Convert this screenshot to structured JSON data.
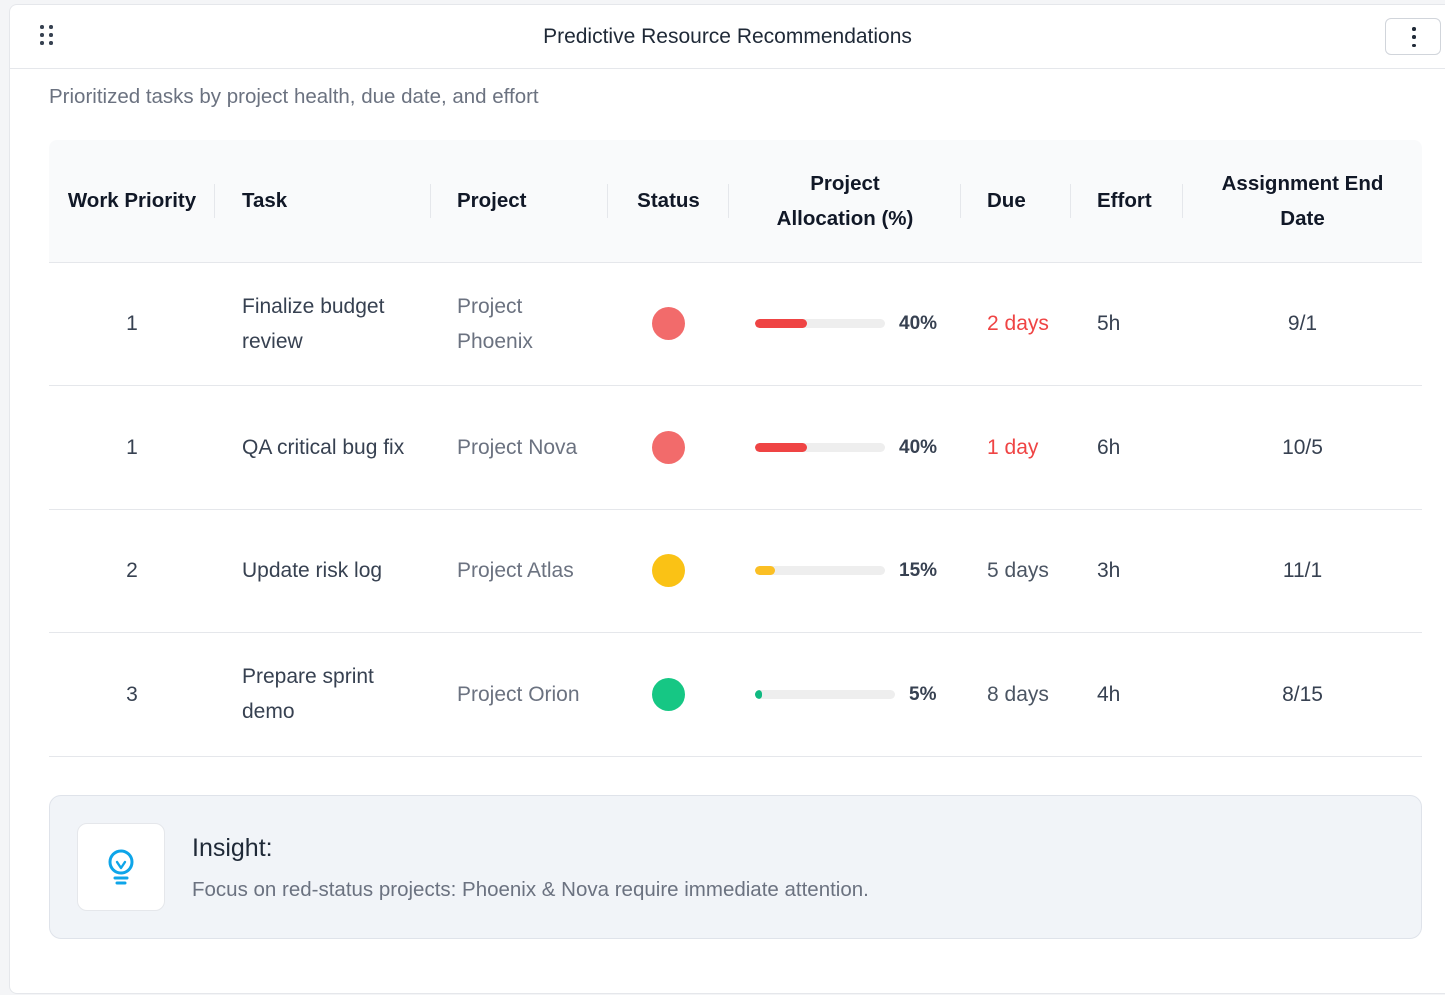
{
  "header": {
    "title": "Predictive Resource Recommendations",
    "menu_icon": "more-vertical-icon",
    "drag_icon": "drag-handle-icon"
  },
  "subtitle": "Prioritized tasks by project health, due date, and effort",
  "table": {
    "columns": [
      {
        "key": "priority",
        "label": "Work Priority"
      },
      {
        "key": "task",
        "label": "Task"
      },
      {
        "key": "project",
        "label": "Project"
      },
      {
        "key": "status",
        "label": "Status"
      },
      {
        "key": "allocation",
        "label": "Project Allocation (%)"
      },
      {
        "key": "due",
        "label": "Due"
      },
      {
        "key": "effort",
        "label": "Effort"
      },
      {
        "key": "end_date",
        "label": "Assignment End Date"
      }
    ],
    "rows": [
      {
        "priority": "1",
        "task": "Finalize budget review",
        "project": "Project Phoenix",
        "status": "red",
        "status_color": "#f26b6b",
        "allocation": 40,
        "allocation_label": "40%",
        "allocation_color": "#ef4444",
        "due": "2 days",
        "due_urgent": true,
        "effort": "5h",
        "end_date": "9/1"
      },
      {
        "priority": "1",
        "task": "QA critical bug fix",
        "project": "Project Nova",
        "status": "red",
        "status_color": "#f26b6b",
        "allocation": 40,
        "allocation_label": "40%",
        "allocation_color": "#ef4444",
        "due": "1 day",
        "due_urgent": true,
        "effort": "6h",
        "end_date": "10/5"
      },
      {
        "priority": "2",
        "task": "Update risk log",
        "project": "Project Atlas",
        "status": "yellow",
        "status_color": "#fac215",
        "allocation": 15,
        "allocation_label": "15%",
        "allocation_color": "#fbbf24",
        "due": "5 days",
        "due_urgent": false,
        "effort": "3h",
        "end_date": "11/1"
      },
      {
        "priority": "3",
        "task": "Prepare sprint demo",
        "project": "Project Orion",
        "status": "green",
        "status_color": "#16c784",
        "allocation": 5,
        "allocation_label": "5%",
        "allocation_color": "#10b981",
        "due": "8 days",
        "due_urgent": false,
        "effort": "4h",
        "end_date": "8/15"
      }
    ]
  },
  "insight": {
    "icon": "lightbulb-icon",
    "icon_color": "#0ea5e9",
    "label": "Insight:",
    "text": "Focus on red-status projects: Phoenix & Nova require immediate attention."
  }
}
